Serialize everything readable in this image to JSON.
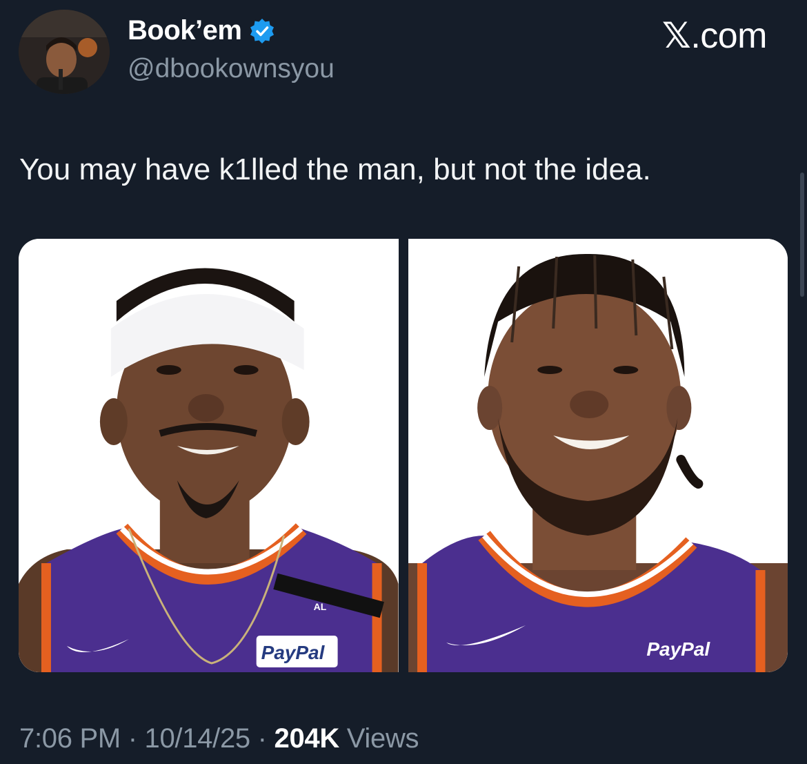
{
  "author": {
    "name": "Book’em",
    "handle": "@dbookownsyou",
    "verified": true
  },
  "site": {
    "glyph": "𝕏",
    "suffix": ".com"
  },
  "tweet": {
    "text": "You may have k1lled the man, but not the idea."
  },
  "media": {
    "photos": [
      {
        "jersey_sponsor": "PayPal",
        "jersey_patch": "AL"
      },
      {
        "jersey_sponsor": "PayPal"
      }
    ]
  },
  "meta": {
    "time": "7:06 PM",
    "separator": " · ",
    "date": "10/14/25",
    "views_count": "204K",
    "views_label": "Views"
  },
  "colors": {
    "background": "#151d29",
    "secondary_text": "#8b98a5",
    "verified_blue": "#1d9bf0",
    "jersey_purple": "#4b2f8f",
    "jersey_orange": "#e56020"
  },
  "icons": {
    "verified": "verified-badge-icon",
    "x_logo": "x-logo-icon"
  }
}
